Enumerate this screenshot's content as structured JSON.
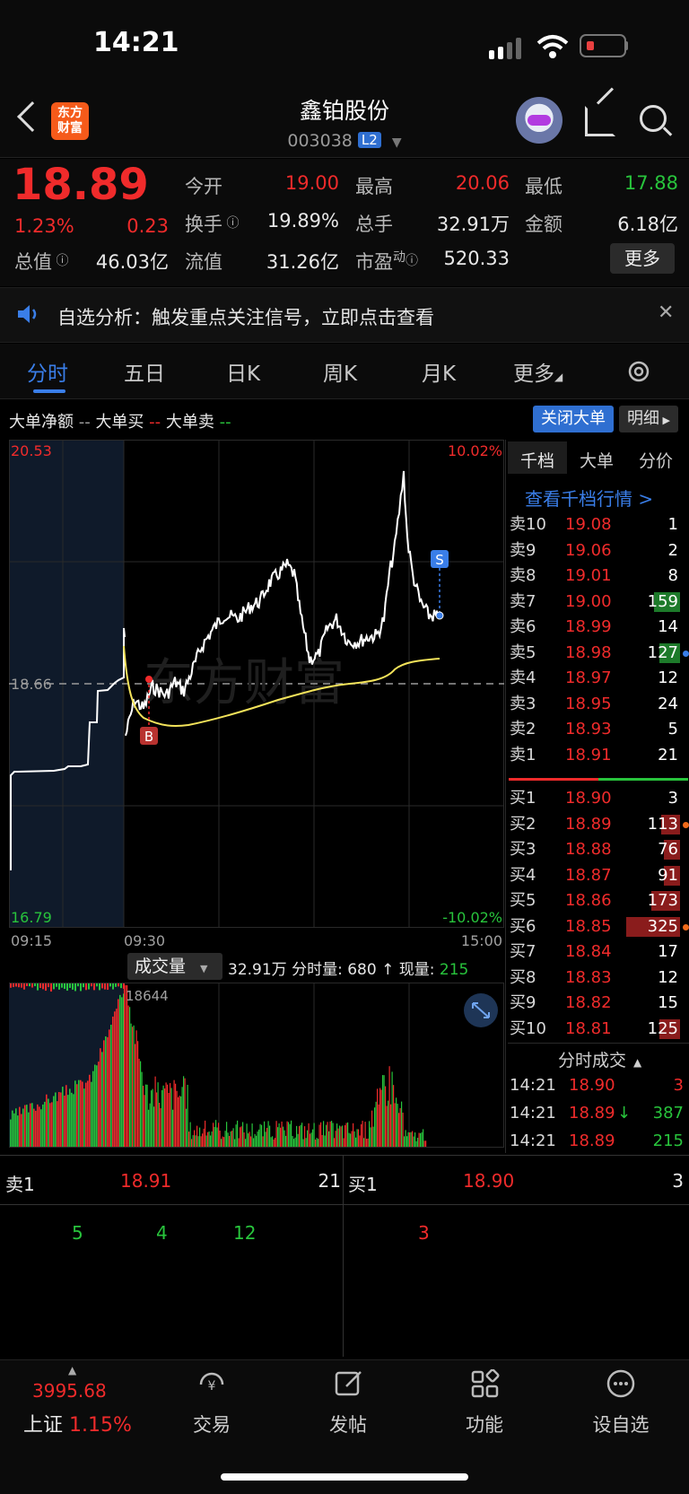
{
  "status_bar": {
    "time": "14:21"
  },
  "header": {
    "logo_line1": "东方",
    "logo_line2": "财富",
    "stock_name": "鑫铂股份",
    "stock_code": "003038",
    "level_badge": "L2"
  },
  "quote": {
    "price": "18.89",
    "change_pct": "1.23%",
    "change_amt": "0.23",
    "open_label": "今开",
    "open": "19.00",
    "high_label": "最高",
    "high": "20.06",
    "low_label": "最低",
    "low": "17.88",
    "turnover_label": "换手",
    "turnover": "19.89%",
    "volume_label": "总手",
    "volume": "32.91万",
    "amount_label": "金额",
    "amount": "6.18亿",
    "mktcap_label": "总值",
    "mktcap": "46.03亿",
    "float_label": "流值",
    "float_cap": "31.26亿",
    "pe_label": "市盈",
    "pe_sup": "动",
    "pe": "520.33",
    "more": "更多"
  },
  "notice": {
    "text": "自选分析：触发重点关注信号，立即点击查看",
    "close": "✕"
  },
  "tabs": [
    "分时",
    "五日",
    "日K",
    "周K",
    "月K",
    "更多"
  ],
  "legend": {
    "net": "大单净额",
    "buy": "大单买",
    "sell": "大单卖",
    "close_big": "关闭大单",
    "detail": "明细"
  },
  "chart": {
    "y_high": "20.53",
    "y_mid": "18.66",
    "y_low": "16.79",
    "pct_high": "10.02%",
    "pct_low": "-10.02%",
    "t_start": "09:15",
    "t_mid": "09:30",
    "t_end": "15:00",
    "watermark": "东方财富",
    "buy_marker": "B",
    "sell_marker": "S",
    "vol_selector": "成交量",
    "vol_total": "32.91万",
    "vol_info_label": "分时量:",
    "vol_info_value": "680",
    "vol_arrow": "↑",
    "cur_vol_label": "现量:",
    "cur_vol_value": "215",
    "vol_peak": "18644"
  },
  "orderbook": {
    "tabs": [
      "千档",
      "大单",
      "分价"
    ],
    "link": "查看千档行情 >",
    "asks": [
      {
        "label": "卖10",
        "price": "19.08",
        "vol": "1"
      },
      {
        "label": "卖9",
        "price": "19.06",
        "vol": "2"
      },
      {
        "label": "卖8",
        "price": "19.01",
        "vol": "8"
      },
      {
        "label": "卖7",
        "price": "19.00",
        "vol": "159"
      },
      {
        "label": "卖6",
        "price": "18.99",
        "vol": "14"
      },
      {
        "label": "卖5",
        "price": "18.98",
        "vol": "127"
      },
      {
        "label": "卖4",
        "price": "18.97",
        "vol": "12"
      },
      {
        "label": "卖3",
        "price": "18.95",
        "vol": "24"
      },
      {
        "label": "卖2",
        "price": "18.93",
        "vol": "5"
      },
      {
        "label": "卖1",
        "price": "18.91",
        "vol": "21"
      }
    ],
    "bids": [
      {
        "label": "买1",
        "price": "18.90",
        "vol": "3"
      },
      {
        "label": "买2",
        "price": "18.89",
        "vol": "113"
      },
      {
        "label": "买3",
        "price": "18.88",
        "vol": "76"
      },
      {
        "label": "买4",
        "price": "18.87",
        "vol": "91"
      },
      {
        "label": "买5",
        "price": "18.86",
        "vol": "173"
      },
      {
        "label": "买6",
        "price": "18.85",
        "vol": "325"
      },
      {
        "label": "买7",
        "price": "18.84",
        "vol": "17"
      },
      {
        "label": "买8",
        "price": "18.83",
        "vol": "12"
      },
      {
        "label": "买9",
        "price": "18.82",
        "vol": "15"
      },
      {
        "label": "买10",
        "price": "18.81",
        "vol": "125"
      }
    ],
    "trades_title": "分时成交",
    "trades": [
      {
        "time": "14:21",
        "price": "18.90",
        "vol": "3",
        "dir": ""
      },
      {
        "time": "14:21",
        "price": "18.89",
        "vol": "387",
        "dir": "↓"
      },
      {
        "time": "14:21",
        "price": "18.89",
        "vol": "215",
        "dir": ""
      }
    ]
  },
  "summary": {
    "sell_label": "卖1",
    "sell_price": "18.91",
    "sell_vol": "21",
    "buy_label": "买1",
    "buy_price": "18.90",
    "buy_vol": "3",
    "sell_queue": [
      "5",
      "4",
      "12"
    ],
    "buy_queue": [
      "3"
    ]
  },
  "bottom_nav": {
    "index_value": "3995.68",
    "index_name": "上证",
    "index_pct": "1.15%",
    "items": [
      "交易",
      "发帖",
      "功能",
      "设自选"
    ]
  },
  "colors": {
    "up": "#f02b2b",
    "down": "#28c43c",
    "accent": "#2f6fd1",
    "avg_line": "#f3e35a"
  }
}
